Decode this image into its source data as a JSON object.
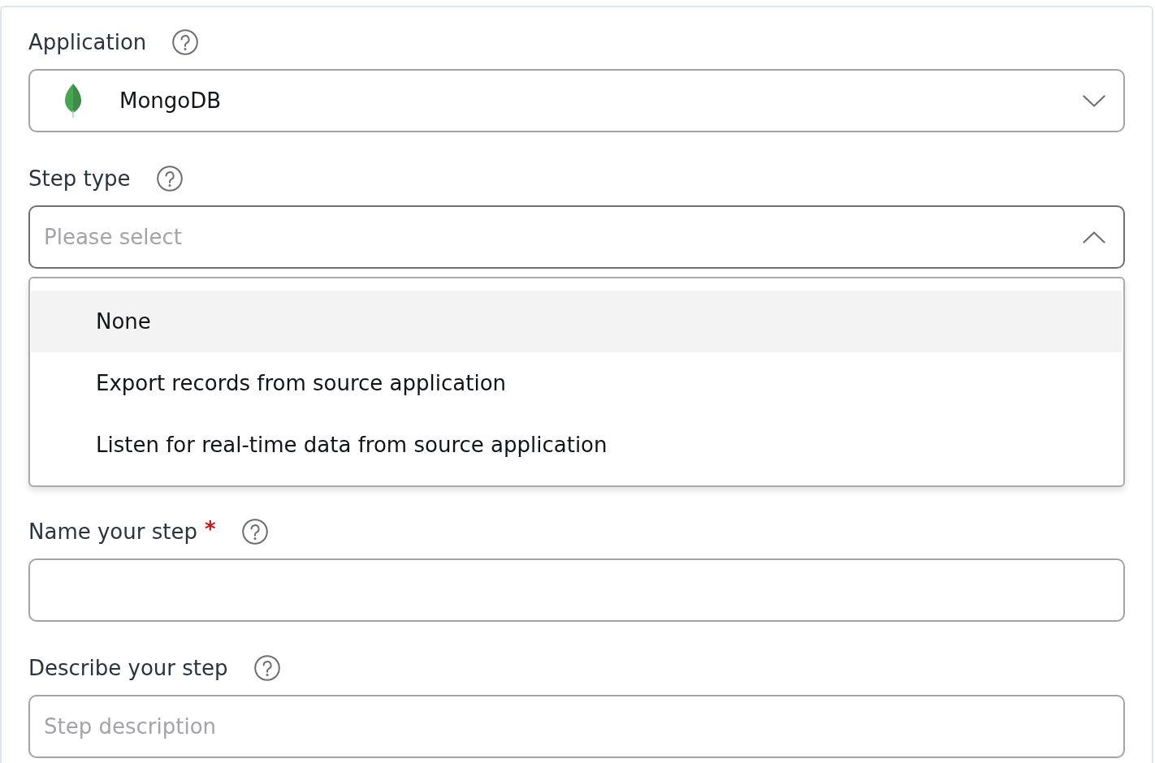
{
  "fields": [
    {
      "kind": "app_select",
      "label": "Application",
      "value": "MongoDB",
      "expanded": false
    },
    {
      "kind": "select",
      "label": "Step type",
      "placeholder": "Please select",
      "expanded": true,
      "options": [
        {
          "label": "None",
          "selected": true
        },
        {
          "label": "Export records from source application",
          "selected": false
        },
        {
          "label": "Listen for real-time data from source application",
          "selected": false
        }
      ]
    },
    {
      "kind": "text",
      "label": "Name your step",
      "required_mark": "*"
    },
    {
      "kind": "text",
      "label": "Describe your step",
      "placeholder": "Step description"
    }
  ]
}
